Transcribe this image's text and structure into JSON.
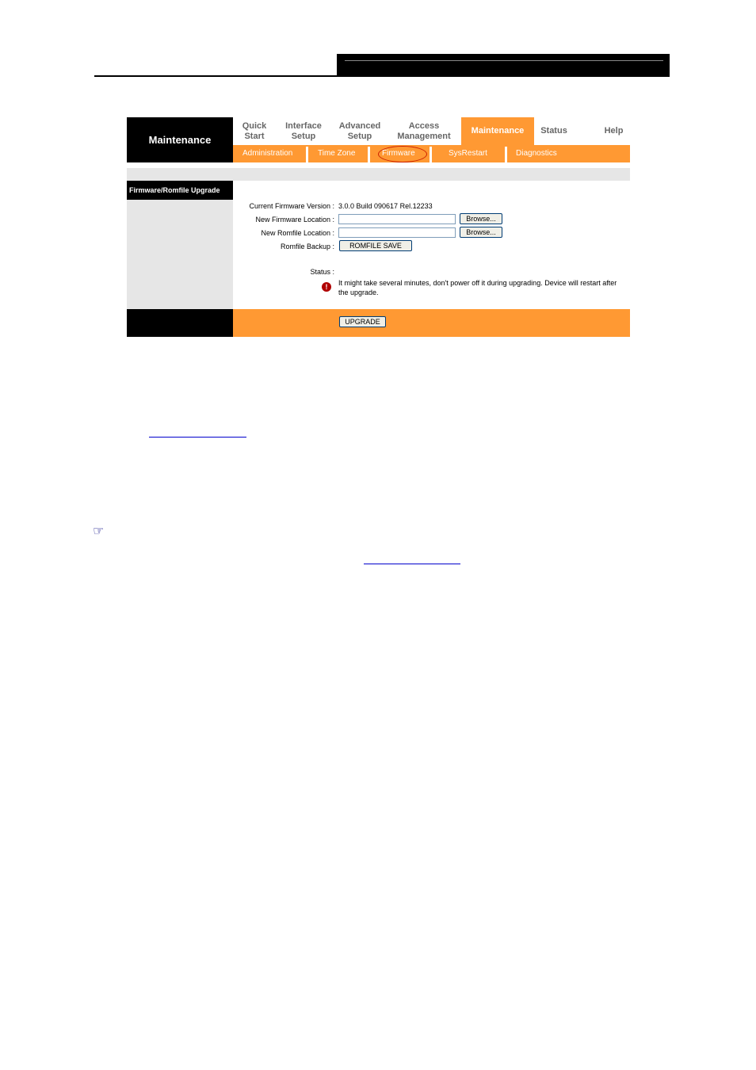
{
  "nav": {
    "brand": "Maintenance",
    "top_items": [
      {
        "line1": "Quick",
        "line2": "Start"
      },
      {
        "line1": "Interface",
        "line2": "Setup"
      },
      {
        "line1": "Advanced",
        "line2": "Setup"
      },
      {
        "line1": "Access",
        "line2": "Management"
      },
      {
        "line1": "Maintenance",
        "line2": ""
      },
      {
        "line1": "Status",
        "line2": ""
      },
      {
        "line1": "Help",
        "line2": ""
      }
    ],
    "active_top": "Maintenance",
    "sub_items": [
      "Administration",
      "Time Zone",
      "Firmware",
      "SysRestart",
      "Diagnostics"
    ],
    "active_sub": "Firmware"
  },
  "section": {
    "title": "Firmware/Romfile Upgrade"
  },
  "form": {
    "current_version_label": "Current Firmware Version :",
    "current_version_value": "3.0.0 Build 090617 Rel.12233",
    "new_firmware_label": "New Firmware Location :",
    "new_firmware_value": "",
    "new_romfile_label": "New Romfile Location :",
    "new_romfile_value": "",
    "browse_label": "Browse...",
    "romfile_backup_label": "Romfile Backup :",
    "romfile_save_label": "ROMFILE SAVE",
    "status_label": "Status :",
    "warning_text": "It might take several minutes, don't power off it during upgrading. Device will restart after the upgrade.",
    "upgrade_label": "UPGRADE"
  },
  "icons": {
    "warning": "exclamation-icon",
    "note": "pointing-hand-icon"
  },
  "colors": {
    "accent": "#ff9933",
    "black": "#000000",
    "gray": "#e6e6e6",
    "link": "#0000cc",
    "highlight_circle": "#cc2200"
  }
}
